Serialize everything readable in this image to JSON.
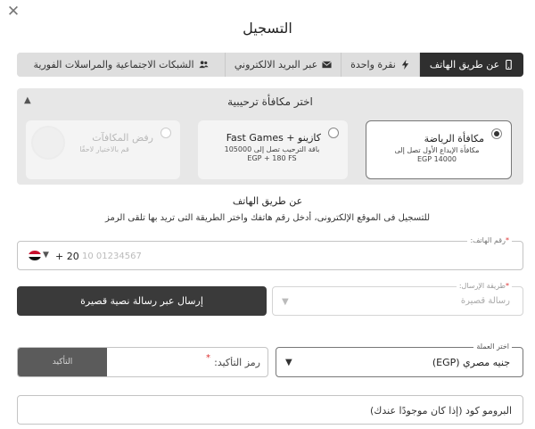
{
  "dialog": {
    "title": "التسجيل",
    "close_symbol": "✕"
  },
  "tabs": [
    {
      "label": "عن طريق الهاتف",
      "icon": "mobile-icon",
      "active": true
    },
    {
      "label": "نقرة واحدة",
      "icon": "lightning-icon",
      "active": false
    },
    {
      "label": "عبر البريد الالكتروني",
      "icon": "envelope-icon",
      "active": false
    },
    {
      "label": "الشبكات الاجتماعية والمراسلات الفورية",
      "icon": "users-icon",
      "active": false
    }
  ],
  "bonus": {
    "header": "اختر مكافأة ترحيبية",
    "cards": [
      {
        "title": "مكافأة الرياضة",
        "desc_line1": "مكافأة الإيداع الأول تصل إلى",
        "desc_line2": "EGP 14000",
        "selected": true
      },
      {
        "title": "كازينو + Fast Games",
        "desc_line1": "باقة الترحيب تصل إلى 105000",
        "desc_line2": "EGP + 180 FS",
        "selected": false
      },
      {
        "title": "رفض المكافآت",
        "desc_line1": "قم بالاختيار لاحقًا",
        "desc_line2": "",
        "selected": false,
        "disabled": true
      }
    ]
  },
  "phone_section": {
    "title": "عن طريق الهاتف",
    "subtitle": "للتسجيل فى الموقع الإلكترونى، أدخل رقم هاتفك واختر الطريقة التى تريد بها تلقى الرمز"
  },
  "phone_field": {
    "label": "رقم الهاتف:",
    "required_mark": "*",
    "country_code": "+ 20",
    "placeholder": "10 01234567"
  },
  "send_button": {
    "label": "إرسال عبر رسالة نصية قصيرة"
  },
  "method_field": {
    "label": "طريقة الإرسال:",
    "required_mark": "*",
    "value": "رسالة قصيرة"
  },
  "confirm": {
    "button_label": "التأكيد",
    "placeholder": "رمز التأكيد:",
    "required_mark": "*"
  },
  "currency_field": {
    "label": "اختر العملة",
    "value": "جنيه مصري (EGP)"
  },
  "promo": {
    "placeholder": "البرومو كود (إذا كان موجودًا عندك)"
  }
}
